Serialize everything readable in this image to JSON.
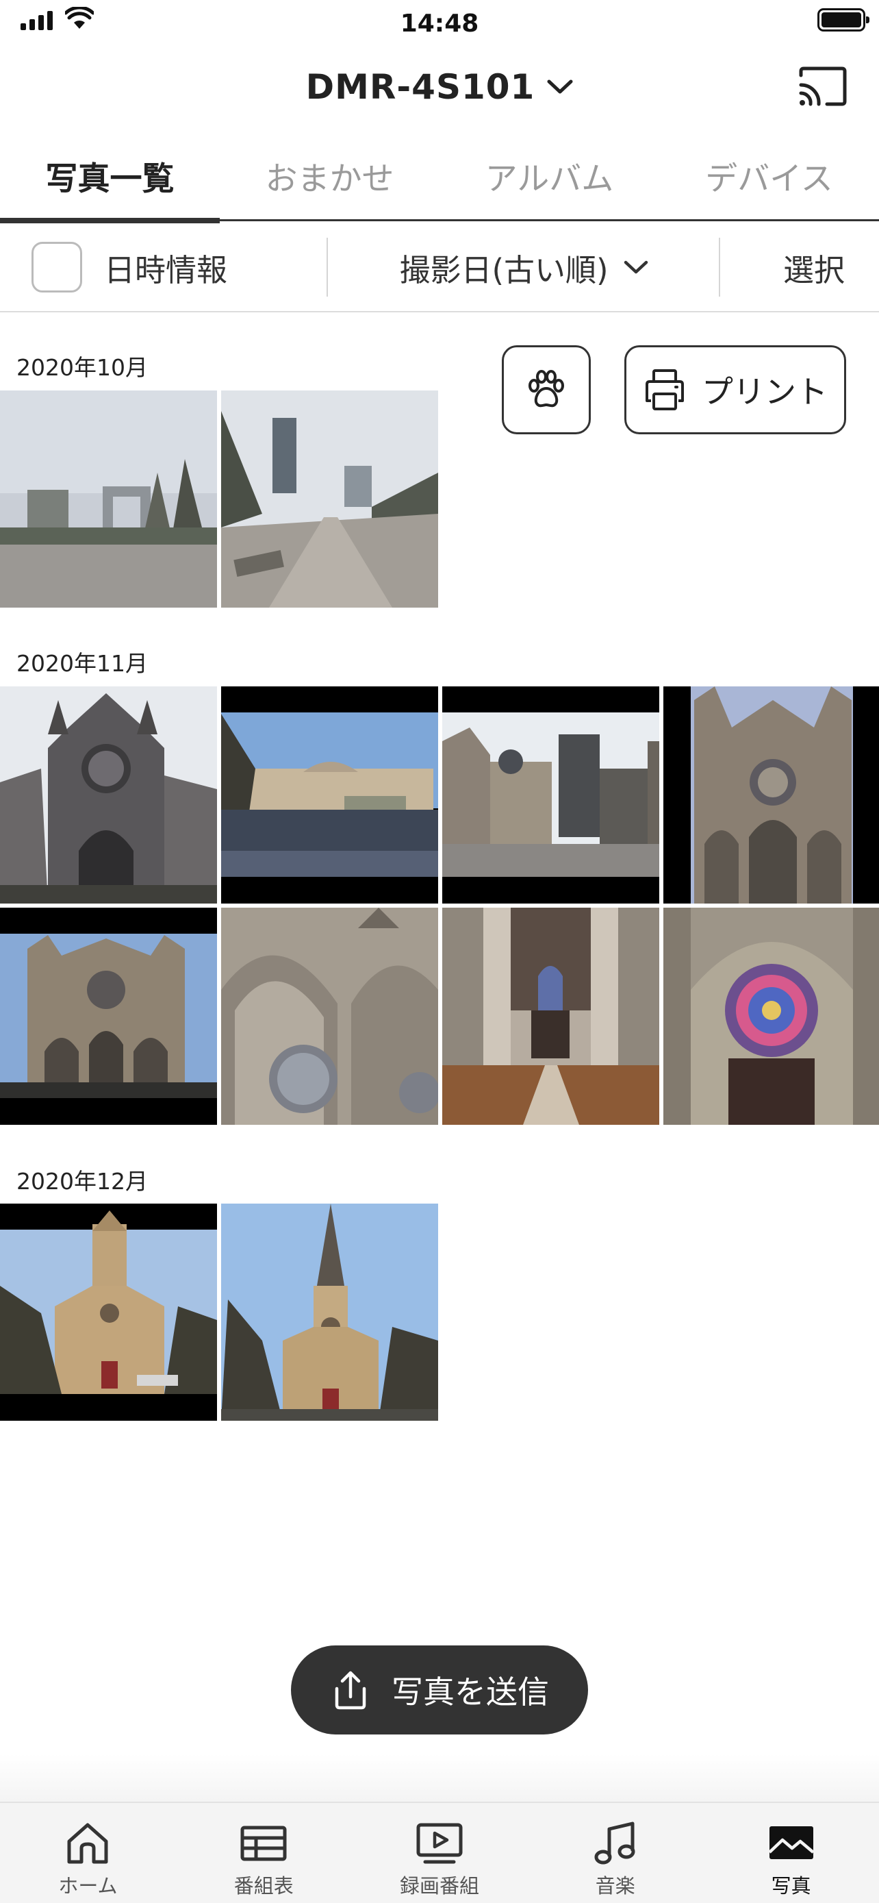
{
  "status_bar": {
    "time": "14:48"
  },
  "header": {
    "device_name": "DMR-4S101",
    "cast_icon": "cast-icon"
  },
  "tabs": [
    {
      "label": "写真一覧",
      "active": true
    },
    {
      "label": "おまかせ",
      "active": false
    },
    {
      "label": "アルバム",
      "active": false
    },
    {
      "label": "デバイス",
      "active": false
    }
  ],
  "toolbar": {
    "date_info_label": "日時情報",
    "date_info_checked": false,
    "sort_label": "撮影日(古い順)",
    "select_label": "選択"
  },
  "actions": {
    "pet_icon": "paw-icon",
    "print_label": "プリント"
  },
  "sections": [
    {
      "month": "2020年10月",
      "photo_count": 2
    },
    {
      "month": "2020年11月",
      "photo_count": 8
    },
    {
      "month": "2020年12月",
      "photo_count": 2
    }
  ],
  "send_button": {
    "label": "写真を送信"
  },
  "bottom_nav": [
    {
      "label": "ホーム",
      "icon": "home-icon",
      "active": false
    },
    {
      "label": "番組表",
      "icon": "tv-guide-icon",
      "active": false
    },
    {
      "label": "録画番組",
      "icon": "recorded-programs-icon",
      "active": false
    },
    {
      "label": "音楽",
      "icon": "music-icon",
      "active": false
    },
    {
      "label": "写真",
      "icon": "photo-icon",
      "active": true
    }
  ],
  "colors": {
    "accent": "#333333",
    "inactive_text": "#9a9a9a",
    "nav_background": "#f4f4f4"
  }
}
